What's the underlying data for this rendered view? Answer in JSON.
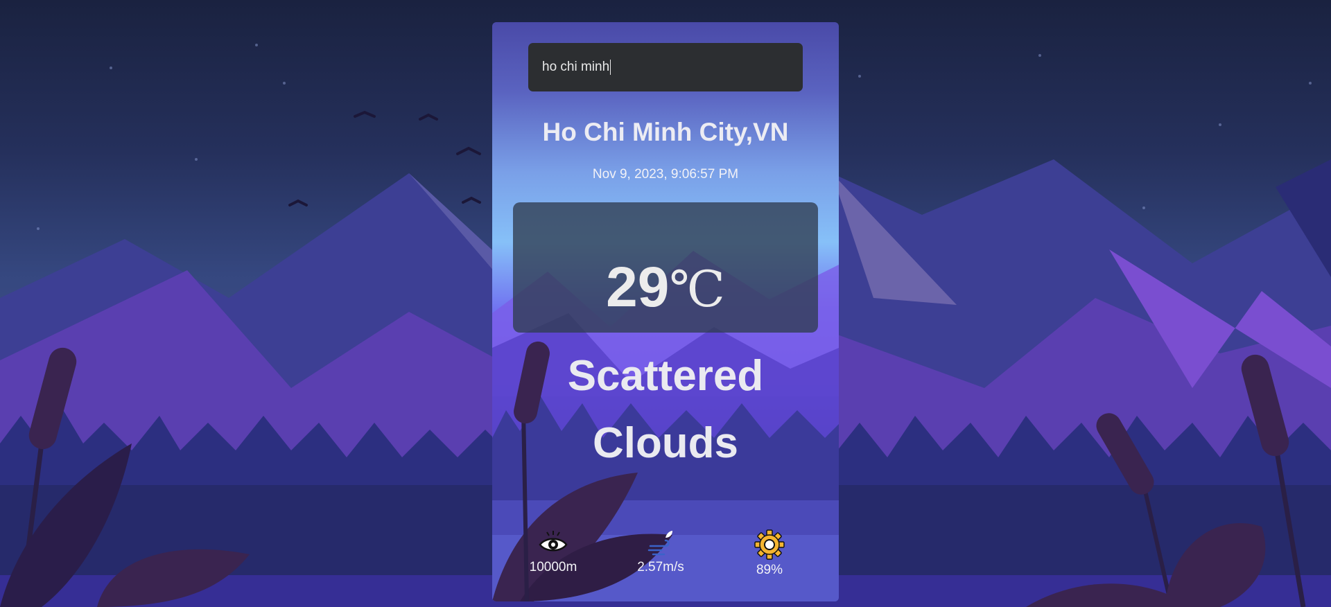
{
  "search": {
    "value": "ho chi minh"
  },
  "location": {
    "name": "Ho Chi Minh City,VN"
  },
  "datetime": "Nov 9, 2023, 9:06:57 PM",
  "weather": {
    "temperature": "29",
    "unit": "℃",
    "description": "Scattered Clouds"
  },
  "stats": {
    "visibility": {
      "icon": "eye-icon",
      "value": "10000m"
    },
    "wind": {
      "icon": "wind-icon",
      "value": "2.57m/s"
    },
    "humidity": {
      "icon": "gear-icon",
      "value": "89%"
    }
  },
  "colors": {
    "search_bg": "#2c2e31",
    "temp_box_bg": "#303c50",
    "text": "#ececf3",
    "humidity_icon": "#f5b531",
    "wind_icon": "#3a63c9"
  }
}
